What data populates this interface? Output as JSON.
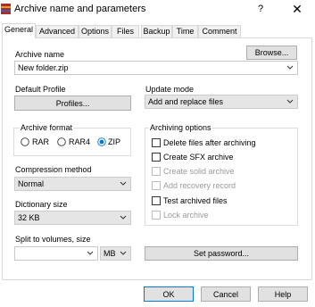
{
  "window": {
    "title": "Archive name and parameters",
    "help": "?",
    "close": "✕"
  },
  "tabs": [
    "General",
    "Advanced",
    "Options",
    "Files",
    "Backup",
    "Time",
    "Comment"
  ],
  "archive_name": {
    "label": "Archive name",
    "value": "New folder.zip",
    "browse": "Browse..."
  },
  "default_profile": {
    "label": "Default Profile",
    "button": "Profiles..."
  },
  "update_mode": {
    "label": "Update mode",
    "value": "Add and replace files"
  },
  "archive_format": {
    "label": "Archive format",
    "options": [
      "RAR",
      "RAR4",
      "ZIP"
    ],
    "selected": "ZIP"
  },
  "compression": {
    "label": "Compression method",
    "value": "Normal"
  },
  "dictionary": {
    "label": "Dictionary size",
    "value": "32 KB"
  },
  "split": {
    "label": "Split to volumes, size",
    "value": "",
    "unit": "MB"
  },
  "archiving_options": {
    "label": "Archiving options",
    "items": [
      {
        "label": "Delete files after archiving",
        "checked": false,
        "enabled": true
      },
      {
        "label": "Create SFX archive",
        "checked": false,
        "enabled": true
      },
      {
        "label": "Create solid archive",
        "checked": false,
        "enabled": false
      },
      {
        "label": "Add recovery record",
        "checked": false,
        "enabled": false
      },
      {
        "label": "Test archived files",
        "checked": false,
        "enabled": true
      },
      {
        "label": "Lock archive",
        "checked": false,
        "enabled": false
      }
    ]
  },
  "set_password": "Set password...",
  "footer": {
    "ok": "OK",
    "cancel": "Cancel",
    "help": "Help"
  },
  "colors": {
    "accent": "#0078d7",
    "button_face": "#e1e1e1",
    "disabled_text": "#9a9a9a",
    "icon_red": "#b32a2a",
    "icon_gold": "#e0a020"
  }
}
